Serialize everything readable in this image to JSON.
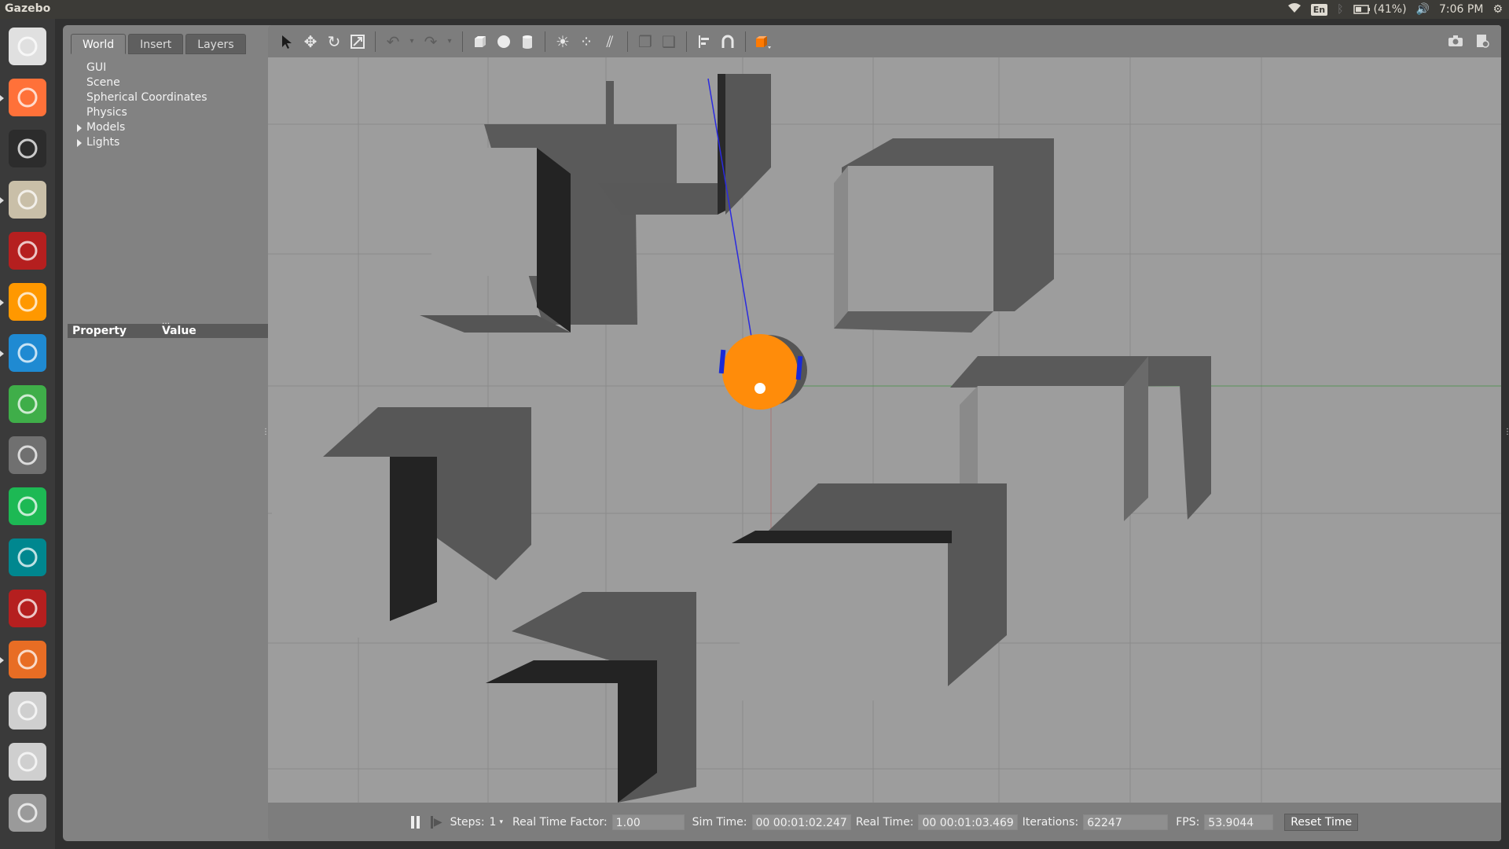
{
  "topbar": {
    "app_title": "Gazebo",
    "keyboard": "En",
    "battery": "(41%)",
    "clock": "7:06 PM"
  },
  "launcher": {
    "items": [
      {
        "name": "ubuntu-dash-icon",
        "color": "#e0e0e0"
      },
      {
        "name": "firefox-icon",
        "color": "#ff7139"
      },
      {
        "name": "terminal-icon",
        "color": "#2c2c2c"
      },
      {
        "name": "files-icon",
        "color": "#c9bfa8"
      },
      {
        "name": "remote-desktop-icon",
        "color": "#b51f1f"
      },
      {
        "name": "sublime-text-icon",
        "color": "#ff9800"
      },
      {
        "name": "vscode-icon",
        "color": "#1f8ad2"
      },
      {
        "name": "spreadsheet-icon",
        "color": "#3fae49"
      },
      {
        "name": "settings-icon",
        "color": "#707070"
      },
      {
        "name": "spotify-icon",
        "color": "#1db954"
      },
      {
        "name": "arduino-icon",
        "color": "#00878f"
      },
      {
        "name": "remote-desktop-2-icon",
        "color": "#b51f1f"
      },
      {
        "name": "software-center-icon",
        "color": "#e86d24"
      },
      {
        "name": "drive-icon",
        "color": "#cfcfcf"
      },
      {
        "name": "drive-2-icon",
        "color": "#cfcfcf"
      },
      {
        "name": "trash-icon",
        "color": "#9a9a9a"
      }
    ]
  },
  "panel": {
    "tabs": [
      "World",
      "Insert",
      "Layers"
    ],
    "tree": [
      "GUI",
      "Scene",
      "Spherical Coordinates",
      "Physics",
      "Models",
      "Lights"
    ],
    "prop_header": {
      "property": "Property",
      "value": "Value"
    }
  },
  "toolbar": {
    "icons": [
      "select-arrow-icon",
      "translate-icon",
      "rotate-icon",
      "scale-icon",
      "undo-icon",
      "redo-icon",
      "box-icon",
      "sphere-icon",
      "cylinder-icon",
      "point-light-icon",
      "spot-light-icon",
      "directional-light-icon",
      "copy-icon",
      "paste-icon",
      "align-icon",
      "snap-icon",
      "view-angle-icon",
      "screenshot-icon",
      "log-icon"
    ]
  },
  "bottom": {
    "steps_label": "Steps:",
    "steps_value": "1",
    "rtf_label": "Real Time Factor:",
    "rtf_value": "1.00",
    "sim_time_label": "Sim Time:",
    "sim_time_value": "00 00:01:02.247",
    "real_time_label": "Real Time:",
    "real_time_value": "00 00:01:03.469",
    "iterations_label": "Iterations:",
    "iterations_value": "62247",
    "fps_label": "FPS:",
    "fps_value": "53.9044",
    "reset_label": "Reset Time"
  },
  "colors": {
    "robot": "#ff8c0a",
    "wheel": "#1a2ad6",
    "laser": "#2a2ae0",
    "floor": "#9d9d9d",
    "wall_face": "#222222",
    "wall_top": "#9d9d9d",
    "shadow": "#555555"
  }
}
